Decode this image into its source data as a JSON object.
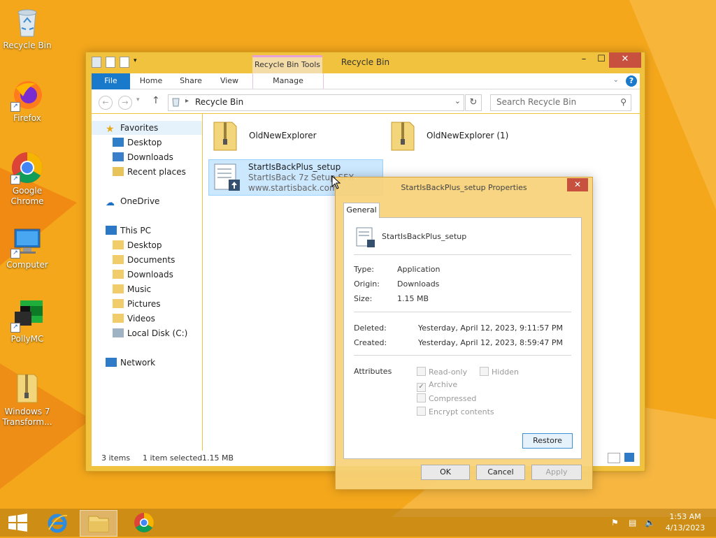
{
  "desktop": {
    "icons": [
      {
        "label": "Recycle Bin",
        "icon": "recycle-bin-icon"
      },
      {
        "label": "Firefox",
        "icon": "firefox-icon"
      },
      {
        "label": "Google Chrome",
        "icon": "chrome-icon"
      },
      {
        "label": "Computer",
        "icon": "computer-icon"
      },
      {
        "label": "PollyMC",
        "icon": "pollymc-icon"
      },
      {
        "label": "Windows 7 Transform...",
        "icon": "zip-folder-icon"
      }
    ]
  },
  "explorer": {
    "title": "Recycle Bin",
    "contextual_tab": "Recycle Bin Tools",
    "ribbon_tabs": [
      "File",
      "Home",
      "Share",
      "View",
      "Manage"
    ],
    "address": "Recycle Bin",
    "search_placeholder": "Search Recycle Bin",
    "nav": {
      "favorites": "Favorites",
      "favorites_items": [
        "Desktop",
        "Downloads",
        "Recent places"
      ],
      "onedrive": "OneDrive",
      "this_pc": "This PC",
      "this_pc_items": [
        "Desktop",
        "Documents",
        "Downloads",
        "Music",
        "Pictures",
        "Videos",
        "Local Disk (C:)"
      ],
      "network": "Network"
    },
    "files": [
      {
        "name": "OldNewExplorer"
      },
      {
        "name": "OldNewExplorer (1)"
      },
      {
        "name": "StartIsBackPlus_setup",
        "desc": "StartIsBack 7z Setup SFX",
        "company": "www.startisback.com"
      }
    ],
    "status": {
      "count": "3 items",
      "selected": "1 item selected",
      "size": "1.15 MB"
    }
  },
  "properties": {
    "title": "StartIsBackPlus_setup Properties",
    "tab": "General",
    "filename": "StartIsBackPlus_setup",
    "rows": [
      {
        "label": "Type:",
        "value": "Application"
      },
      {
        "label": "Origin:",
        "value": "Downloads"
      },
      {
        "label": "Size:",
        "value": "1.15 MB"
      }
    ],
    "dates": [
      {
        "label": "Deleted:",
        "value": "Yesterday, April 12, 2023, 9:11:57 PM"
      },
      {
        "label": "Created:",
        "value": "Yesterday, April 12, 2023, 8:59:47 PM"
      }
    ],
    "attributes_label": "Attributes",
    "attributes": [
      {
        "label": "Read-only",
        "checked": false
      },
      {
        "label": "Hidden",
        "checked": false
      },
      {
        "label": "Archive",
        "checked": true
      },
      {
        "label": "Compressed",
        "checked": false
      },
      {
        "label": "Encrypt contents",
        "checked": false
      }
    ],
    "restore": "Restore",
    "ok": "OK",
    "cancel": "Cancel",
    "apply": "Apply"
  },
  "taskbar": {
    "time": "1:53 AM",
    "date": "4/13/2023"
  },
  "colors": {
    "accent": "#1979ca",
    "desktop": "#f3a51c",
    "close": "#c7503f"
  }
}
